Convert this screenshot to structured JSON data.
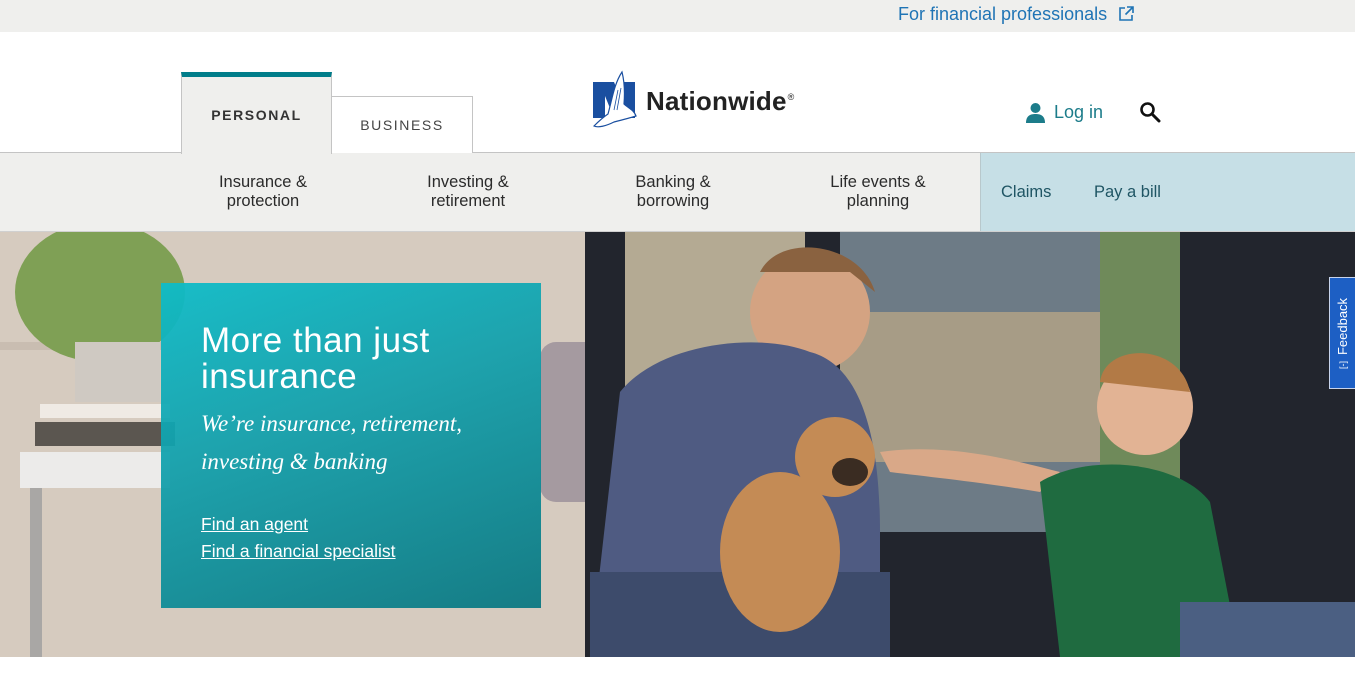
{
  "utility": {
    "pro_link": "For financial professionals",
    "pro_link_icon": "external-link-icon"
  },
  "header": {
    "tabs": [
      {
        "label": "PERSONAL",
        "active": true
      },
      {
        "label": "BUSINESS",
        "active": false
      }
    ],
    "logo": {
      "text": "Nationwide",
      "reg": "®"
    },
    "login_label": "Log in",
    "login_icon": "user-icon",
    "search_icon": "search-icon"
  },
  "nav": {
    "items": [
      {
        "line1": "Insurance &",
        "line2": "protection"
      },
      {
        "line1": "Investing &",
        "line2": "retirement"
      },
      {
        "line1": "Banking &",
        "line2": "borrowing"
      },
      {
        "line1": "Life events &",
        "line2": "planning"
      }
    ],
    "quick": [
      {
        "label": "Claims"
      },
      {
        "label": "Pay a bill"
      }
    ]
  },
  "hero": {
    "title": "More than just insurance",
    "subtitle": "We’re insurance, retirement, investing & banking",
    "links": [
      {
        "label": "Find an agent"
      },
      {
        "label": "Find a financial specialist"
      }
    ]
  },
  "feedback": {
    "label": "Feedback",
    "icon": "[-]"
  },
  "colors": {
    "brand_teal": "#007d8a",
    "brand_blue": "#1a4fa0",
    "link_blue": "#1f74b5",
    "quick_bg": "#c6dfe6",
    "feedback_bg": "#1d5fc4"
  }
}
